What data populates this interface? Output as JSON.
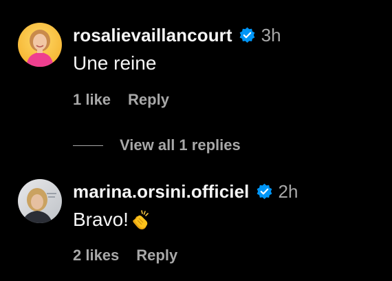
{
  "comments": [
    {
      "username": "rosalievaillancourt",
      "verified": true,
      "time": "3h",
      "text": "Une reine",
      "likes": "1 like",
      "reply": "Reply",
      "avatar": "avatar-photo-woman-pink-top"
    },
    {
      "username": "marina.orsini.officiel",
      "verified": true,
      "time": "2h",
      "text": "Bravo!",
      "emoji": "clapping-hands-icon",
      "likes": "2 likes",
      "reply": "Reply",
      "avatar": "avatar-photo-woman-blonde"
    }
  ],
  "view_replies": "View all 1 replies",
  "colors": {
    "background": "#000000",
    "primary_text": "#f5f5f5",
    "secondary_text": "#a8a8a8",
    "verified_badge": "#0095f6"
  }
}
